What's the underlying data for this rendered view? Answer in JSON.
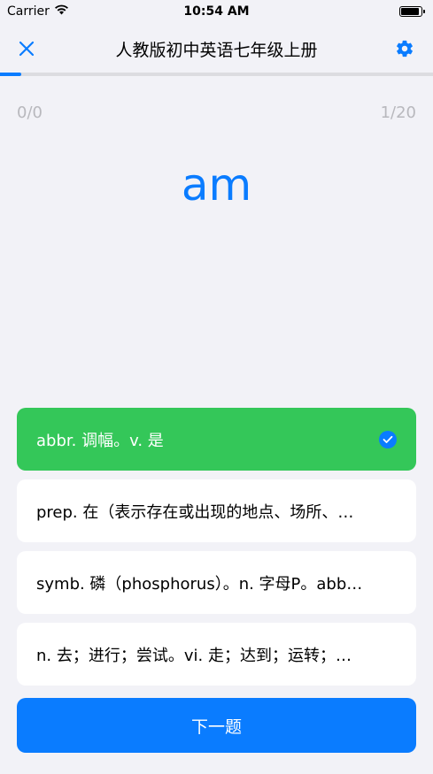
{
  "status_bar": {
    "carrier": "Carrier",
    "time": "10:54 AM",
    "battery_level": 0.9
  },
  "nav": {
    "title": "人教版初中英语七年级上册",
    "close_icon": "close-icon",
    "settings_icon": "gear-icon",
    "accent_color": "#0a7cff"
  },
  "progress": {
    "fraction": 0.05
  },
  "counters": {
    "score": "0/0",
    "position": "1/20"
  },
  "word": "am",
  "options": [
    {
      "text": "abbr. 调幅。v. 是",
      "state": "correct"
    },
    {
      "text": "prep. 在（表示存在或出现的地点、场所、…",
      "state": "normal"
    },
    {
      "text": "symb. 磷（phosphorus）。n. 字母P。abb…",
      "state": "normal"
    },
    {
      "text": "n. 去；进行；尝试。vi. 走；达到；运转；…",
      "state": "normal"
    }
  ],
  "next_button": {
    "label": "下一题"
  },
  "colors": {
    "correct": "#34c759",
    "primary": "#0a7cff",
    "background": "#f2f2f7"
  }
}
